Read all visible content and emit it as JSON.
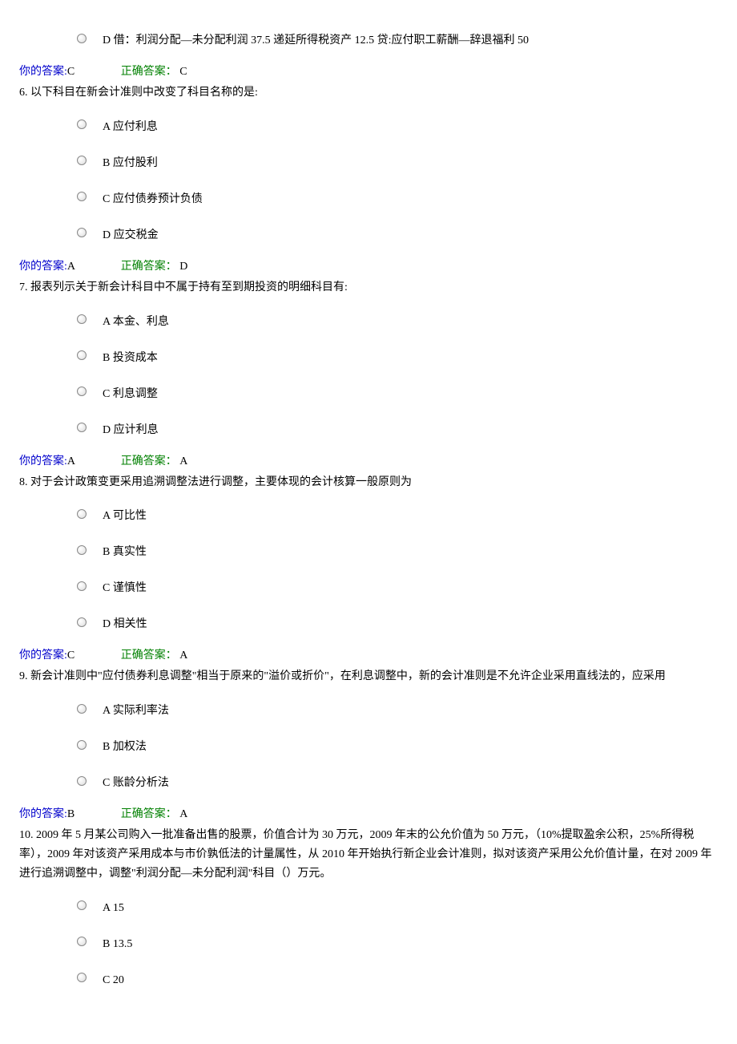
{
  "labels": {
    "yourAnswer": "你的答案:",
    "correctAnswer": "正确答案："
  },
  "q5": {
    "optD": "D 借：利润分配—未分配利润 37.5 递延所得税资产 12.5 贷:应付职工薪酬—辞退福利 50",
    "your": "C",
    "correct": " C"
  },
  "q6": {
    "prompt": "6. 以下科目在新会计准则中改变了科目名称的是:",
    "optA": "A 应付利息",
    "optB": "B 应付股利",
    "optC": "C 应付债券预计负债",
    "optD": "D 应交税金",
    "your": "A",
    "correct": " D"
  },
  "q7": {
    "prompt": "7. 报表列示关于新会计科目中不属于持有至到期投资的明细科目有:",
    "optA": "A 本金、利息",
    "optB": "B 投资成本",
    "optC": "C 利息调整",
    "optD": "D 应计利息",
    "your": "A",
    "correct": " A"
  },
  "q8": {
    "prompt": "8. 对于会计政策变更采用追溯调整法进行调整，主要体现的会计核算一般原则为",
    "optA": "A 可比性",
    "optB": "B 真实性",
    "optC": "C 谨慎性",
    "optD": "D 相关性",
    "your": "C",
    "correct": " A"
  },
  "q9": {
    "prompt": "9. 新会计准则中\"应付债券利息调整\"相当于原来的\"溢价或折价\"，在利息调整中，新的会计准则是不允许企业采用直线法的，应采用",
    "optA": "A 实际利率法",
    "optB": "B 加权法",
    "optC": "C 账龄分析法",
    "your": "B",
    "correct": " A"
  },
  "q10": {
    "prompt": "10. 2009 年 5 月某公司购入一批准备出售的股票，价值合计为 30 万元，2009 年末的公允价值为 50 万元，（10%提取盈余公积，25%所得税率），2009 年对该资产采用成本与市价孰低法的计量属性，从 2010 年开始执行新企业会计准则，拟对该资产采用公允价值计量，在对 2009 年进行追溯调整中，调整\"利润分配—未分配利润\"科目（）万元。",
    "optA": "A 15",
    "optB": "B 13.5",
    "optC": "C 20"
  }
}
